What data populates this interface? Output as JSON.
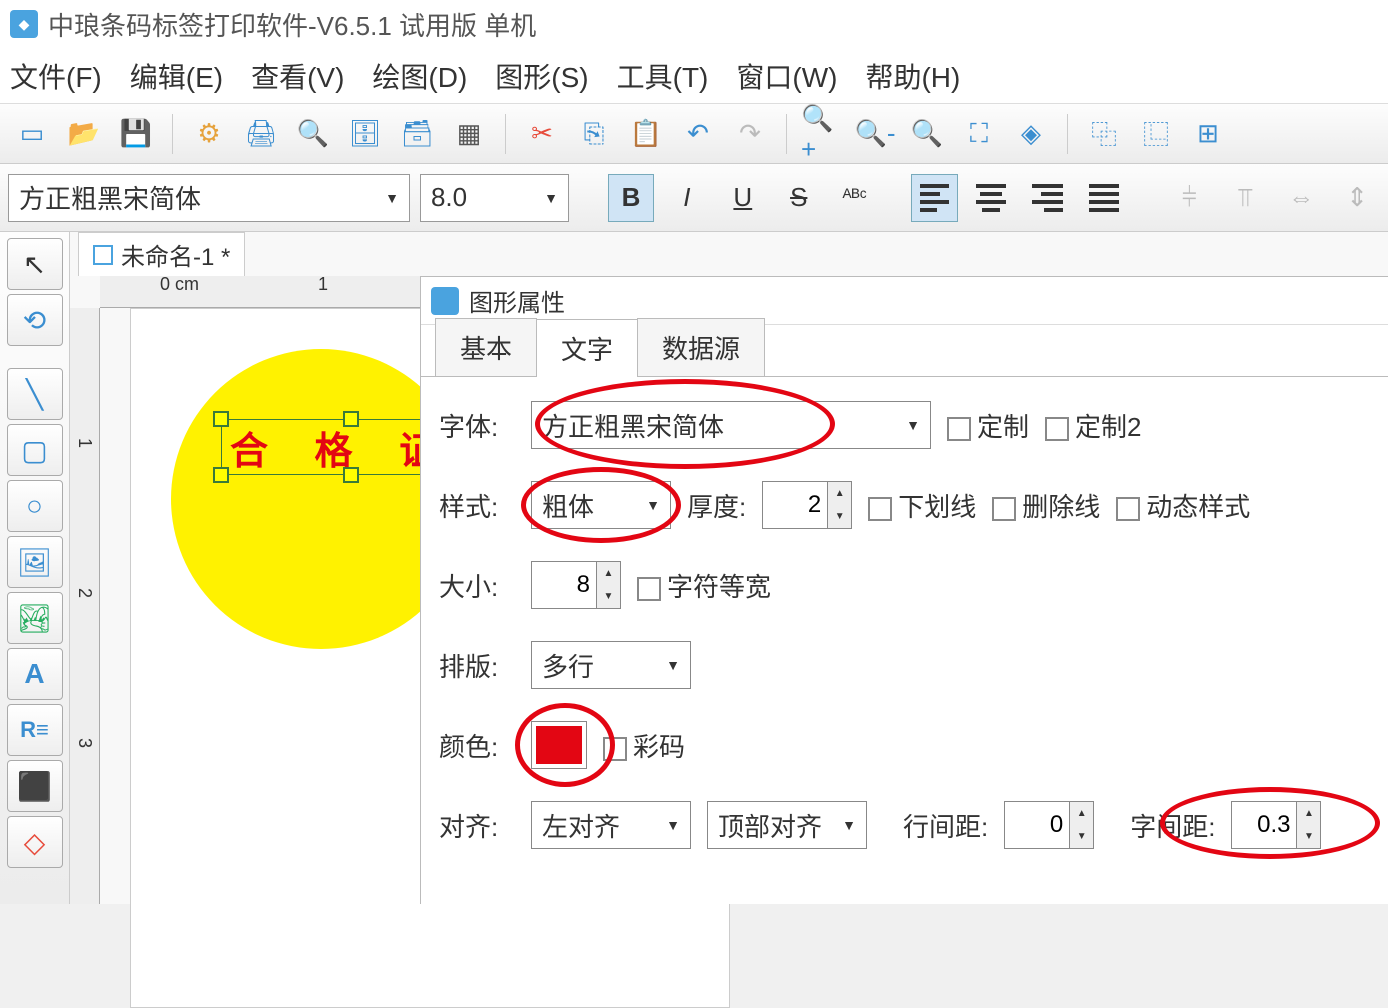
{
  "app": {
    "title": "中琅条码标签打印软件-V6.5.1 试用版 单机"
  },
  "menu": {
    "file": "文件(F)",
    "edit": "编辑(E)",
    "view": "查看(V)",
    "draw": "绘图(D)",
    "shape": "图形(S)",
    "tool": "工具(T)",
    "window": "窗口(W)",
    "help": "帮助(H)"
  },
  "format": {
    "font": "方正粗黑宋简体",
    "size": "8.0"
  },
  "doc": {
    "tab": "未命名-1 *"
  },
  "ruler": {
    "zero": "0 cm",
    "one": "1",
    "two": "2",
    "three": "3"
  },
  "canvas": {
    "text": "合 格 证"
  },
  "panel": {
    "title": "图形属性",
    "tabs": {
      "basic": "基本",
      "text": "文字",
      "data": "数据源"
    },
    "labels": {
      "font": "字体:",
      "custom": "定制",
      "custom2": "定制2",
      "style": "样式:",
      "thickness": "厚度:",
      "underline": "下划线",
      "strike": "删除线",
      "dynamic": "动态样式",
      "size": "大小:",
      "monospace": "字符等宽",
      "layout": "排版:",
      "color": "颜色:",
      "colorcode": "彩码",
      "align": "对齐:",
      "linespace": "行间距:",
      "charspace": "字间距:"
    },
    "values": {
      "font": "方正粗黑宋简体",
      "style": "粗体",
      "thickness": "2",
      "size": "8",
      "layout": "多行",
      "halign": "左对齐",
      "valign": "顶部对齐",
      "linespace": "0",
      "charspace": "0.3",
      "color": "#e30613"
    }
  }
}
